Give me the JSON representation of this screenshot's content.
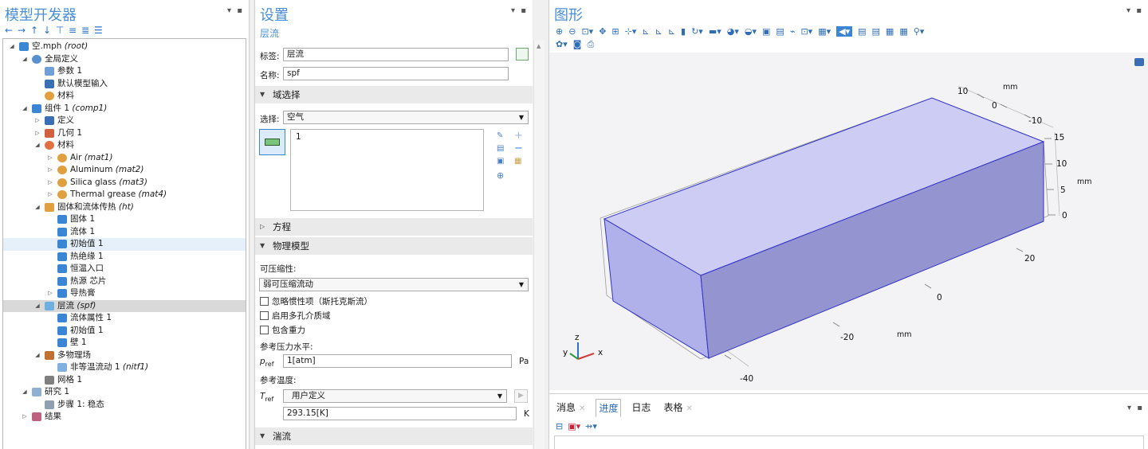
{
  "model_builder": {
    "title": "模型开发器",
    "toolbar_icons": [
      "arrow-left-icon",
      "arrow-right-icon",
      "arrow-up-icon",
      "arrow-down-icon",
      "filter-icon",
      "expand-all-icon",
      "collapse-all-icon",
      "tree-view-icon"
    ],
    "tree": [
      {
        "label": "空.mph",
        "tag": "(root)",
        "level": 0,
        "toggle": "open",
        "icon": "root-icon"
      },
      {
        "label": "全局定义",
        "level": 1,
        "toggle": "open",
        "icon": "globe-icon"
      },
      {
        "label": "参数 1",
        "level": 2,
        "icon": "parameter-icon"
      },
      {
        "label": "默认模型输入",
        "level": 2,
        "icon": "model-input-icon"
      },
      {
        "label": "材料",
        "level": 2,
        "icon": "material-icon"
      },
      {
        "label": "组件 1",
        "tag": "(comp1)",
        "level": 1,
        "toggle": "open",
        "icon": "component-icon"
      },
      {
        "label": "定义",
        "level": 2,
        "toggle": "closed",
        "icon": "definitions-icon"
      },
      {
        "label": "几何 1",
        "level": 2,
        "toggle": "closed",
        "icon": "geometry-icon"
      },
      {
        "label": "材料",
        "level": 2,
        "toggle": "open",
        "icon": "materials-icon"
      },
      {
        "label": "Air",
        "tag": "(mat1)",
        "level": 3,
        "toggle": "closed",
        "icon": "material-icon"
      },
      {
        "label": "Aluminum",
        "tag": "(mat2)",
        "level": 3,
        "toggle": "closed",
        "icon": "material-icon"
      },
      {
        "label": "Silica glass",
        "tag": "(mat3)",
        "level": 3,
        "toggle": "closed",
        "icon": "material-icon"
      },
      {
        "label": "Thermal grease",
        "tag": "(mat4)",
        "level": 3,
        "toggle": "closed",
        "icon": "material-icon"
      },
      {
        "label": "固体和流体传热",
        "tag": "(ht)",
        "level": 2,
        "toggle": "open",
        "icon": "heat-transfer-icon"
      },
      {
        "label": "固体 1",
        "level": 3,
        "icon": "domain-feature-icon"
      },
      {
        "label": "流体 1",
        "level": 3,
        "icon": "domain-feature-icon"
      },
      {
        "label": "初始值 1",
        "level": 3,
        "icon": "domain-feature-icon",
        "highlight": "light"
      },
      {
        "label": "热绝缘 1",
        "level": 3,
        "icon": "domain-feature-icon"
      },
      {
        "label": "恒温入口",
        "level": 3,
        "icon": "boundary-feature-icon"
      },
      {
        "label": "热源 芯片",
        "level": 3,
        "icon": "boundary-feature-icon"
      },
      {
        "label": "导热膏",
        "level": 3,
        "toggle": "closed",
        "icon": "boundary-feature-icon"
      },
      {
        "label": "层流",
        "tag": "(spf)",
        "level": 2,
        "toggle": "open",
        "icon": "laminar-flow-icon",
        "highlight": "gray"
      },
      {
        "label": "流体属性 1",
        "level": 3,
        "icon": "domain-feature-icon"
      },
      {
        "label": "初始值 1",
        "level": 3,
        "icon": "domain-feature-icon"
      },
      {
        "label": "壁 1",
        "level": 3,
        "icon": "domain-feature-icon"
      },
      {
        "label": "多物理场",
        "level": 2,
        "toggle": "open",
        "icon": "multiphysics-icon"
      },
      {
        "label": "非等温流动 1",
        "tag": "(nitf1)",
        "level": 3,
        "icon": "coupling-icon"
      },
      {
        "label": "网格 1",
        "level": 2,
        "icon": "mesh-icon"
      },
      {
        "label": "研究 1",
        "level": 1,
        "toggle": "open",
        "icon": "study-icon"
      },
      {
        "label": "步骤 1: 稳态",
        "level": 2,
        "icon": "study-step-icon"
      },
      {
        "label": "结果",
        "level": 1,
        "toggle": "closed",
        "icon": "results-icon"
      }
    ]
  },
  "settings": {
    "title": "设置",
    "subtitle": "层流",
    "label_caption": "标签:",
    "label_value": "层流",
    "name_caption": "名称:",
    "name_value": "spf",
    "sec_domain": "域选择",
    "select_caption": "选择:",
    "select_value": "空气",
    "selection_list": [
      "1"
    ],
    "sec_equation": "方程",
    "sec_physics": "物理模型",
    "compressibility_caption": "可压缩性:",
    "compressibility_value": "弱可压缩流动",
    "checkboxes": [
      "忽略惯性项（斯托克斯流）",
      "启用多孔介质域",
      "包含重力"
    ],
    "ref_pressure_caption": "参考压力水平:",
    "pref_symbol": "p",
    "pref_sub": "ref",
    "pref_value": "1[atm]",
    "pref_unit": "Pa",
    "ref_temp_caption": "参考温度:",
    "tref_symbol": "T",
    "tref_sub": "ref",
    "tref_mode": "用户定义",
    "tref_value": "293.15[K]",
    "tref_unit": "K",
    "sec_turbulence": "湍流"
  },
  "graphics": {
    "title": "图形",
    "axis_labels": {
      "top": [
        "10",
        "0",
        "-10"
      ],
      "top_unit": "mm",
      "right": [
        "15",
        "10",
        "5",
        "0"
      ],
      "right_unit": "mm",
      "right_front": [
        "20"
      ],
      "front_x": [
        "0",
        "-20",
        "-40"
      ],
      "front_unit": "mm"
    },
    "triad": {
      "x": "x",
      "y": "y",
      "z": "z"
    },
    "box_color": "#9999dd"
  },
  "bottom": {
    "tabs": [
      {
        "label": "消息",
        "closable": true
      },
      {
        "label": "进度",
        "closable": false,
        "active": true
      },
      {
        "label": "日志",
        "closable": false
      },
      {
        "label": "表格",
        "closable": true
      }
    ]
  }
}
